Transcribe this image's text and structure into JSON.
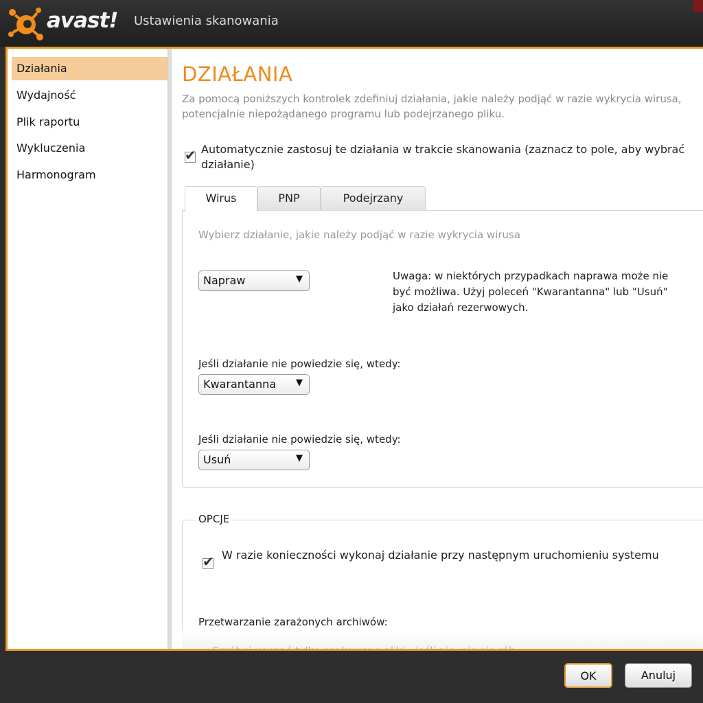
{
  "app": {
    "logo_text": "avast!",
    "window_title": "Ustawienia skanowania",
    "accent": "#e59a2b"
  },
  "sidebar": {
    "items": [
      {
        "label": "Działania",
        "active": true
      },
      {
        "label": "Wydajność",
        "active": false
      },
      {
        "label": "Plik raportu",
        "active": false
      },
      {
        "label": "Wykluczenia",
        "active": false
      },
      {
        "label": "Harmonogram",
        "active": false
      }
    ]
  },
  "main": {
    "heading": "DZIAŁANIA",
    "description": "Za pomocą poniższych kontrolek zdefiniuj działania, jakie należy podjąć w razie wykrycia wirusa, potencjalnie niepożądanego programu lub podejrzanego pliku.",
    "auto_checkbox": {
      "label": "Automatycznie zastosuj te działania w trakcie skanowania (zaznacz to pole, aby wybrać działanie)",
      "checked": true
    },
    "tabs": [
      {
        "label": "Wirus",
        "active": true
      },
      {
        "label": "PNP",
        "active": false
      },
      {
        "label": "Podejrzany",
        "active": false
      }
    ],
    "panel": {
      "hint": "Wybierz działanie, jakie należy podjąć w razie wykrycia wirusa",
      "primary_action": "Napraw",
      "note": "Uwaga: w niektórych przypadkach naprawa może nie być możliwa. Użyj poleceń \"Kwarantanna\" lub \"Usuń\" jako działań rezerwowych.",
      "fallback1_label": "Jeśli działanie nie powiedzie się, wtedy:",
      "fallback1_value": "Kwarantanna",
      "fallback2_label": "Jeśli działanie nie powiedzie się, wtedy:",
      "fallback2_value": "Usuń"
    },
    "options": {
      "legend": "OPCJE",
      "reboot_checkbox": {
        "label": "W razie konieczności wykonaj działanie przy następnym uruchomieniu systemu",
        "checked": true
      },
      "archives_label": "Przetwarzanie zarażonych archiwów:",
      "archives_first_option": "Spróbuj usunąć tylko spakowane pliki - jeśli nie, nic nie rób"
    }
  },
  "footer": {
    "ok_label": "OK",
    "cancel_label": "Anuluj"
  }
}
